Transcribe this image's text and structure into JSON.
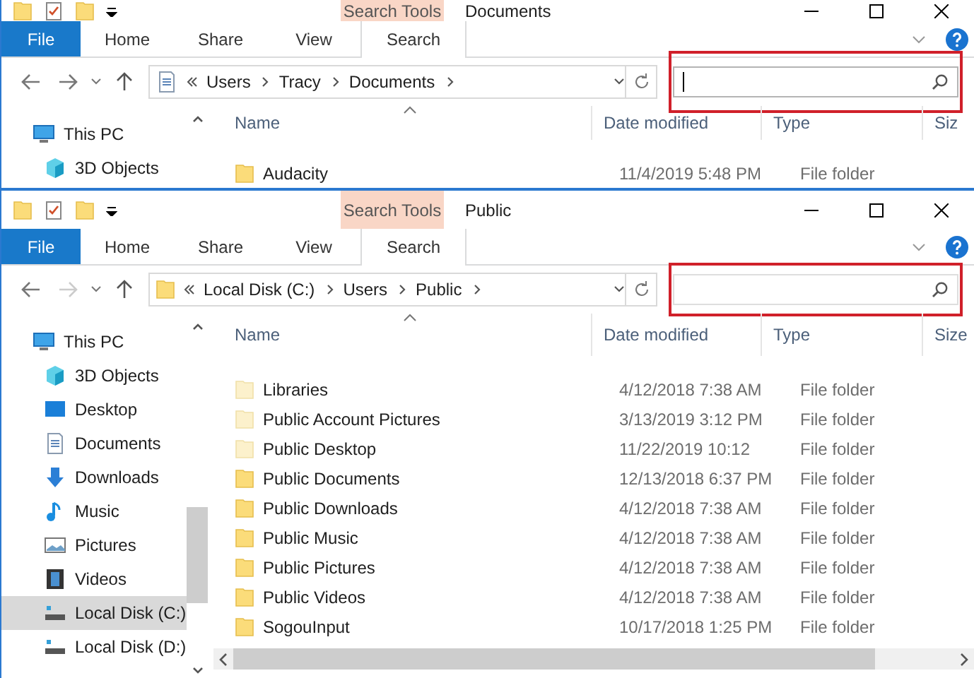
{
  "windows": [
    {
      "title": "Documents",
      "context_tab": "Search Tools",
      "ribbon_tabs": [
        {
          "label": "File",
          "kind": "file",
          "selected": false
        },
        {
          "label": "Home",
          "kind": "tab",
          "selected": false
        },
        {
          "label": "Share",
          "kind": "tab",
          "selected": false
        },
        {
          "label": "View",
          "kind": "tab",
          "selected": false
        },
        {
          "label": "Search",
          "kind": "tab",
          "selected": true
        }
      ],
      "location": {
        "kind": "documents"
      },
      "breadcrumb": [
        "Users",
        "Tracy",
        "Documents"
      ],
      "forward_enabled": true,
      "search": {
        "focused": true,
        "highlighted": true
      },
      "sidebar": [
        {
          "label": "This PC",
          "kind": "pc",
          "selected": false
        },
        {
          "label": "3D Objects",
          "kind": "objects",
          "selected": false
        }
      ],
      "columns": [
        "Name",
        "Date modified",
        "Type",
        "Siz"
      ],
      "rows": [
        {
          "name": "Audacity",
          "date": "11/4/2019 5:48 PM",
          "type": "File folder",
          "hidden": false
        }
      ]
    },
    {
      "title": "Public",
      "context_tab": "Search Tools",
      "ribbon_tabs": [
        {
          "label": "File",
          "kind": "file",
          "selected": false
        },
        {
          "label": "Home",
          "kind": "tab",
          "selected": false
        },
        {
          "label": "Share",
          "kind": "tab",
          "selected": false
        },
        {
          "label": "View",
          "kind": "tab",
          "selected": false
        },
        {
          "label": "Search",
          "kind": "tab",
          "selected": true
        }
      ],
      "location": {
        "kind": "folder"
      },
      "breadcrumb": [
        "Local Disk (C:)",
        "Users",
        "Public"
      ],
      "forward_enabled": false,
      "search": {
        "focused": false,
        "highlighted": true
      },
      "sidebar": [
        {
          "label": "This PC",
          "kind": "pc",
          "selected": false
        },
        {
          "label": "3D Objects",
          "kind": "objects",
          "selected": false
        },
        {
          "label": "Desktop",
          "kind": "desktop",
          "selected": false
        },
        {
          "label": "Documents",
          "kind": "documents",
          "selected": false
        },
        {
          "label": "Downloads",
          "kind": "downloads",
          "selected": false
        },
        {
          "label": "Music",
          "kind": "music",
          "selected": false
        },
        {
          "label": "Pictures",
          "kind": "pictures",
          "selected": false
        },
        {
          "label": "Videos",
          "kind": "videos",
          "selected": false
        },
        {
          "label": "Local Disk (C:)",
          "kind": "drive",
          "selected": true
        },
        {
          "label": "Local Disk (D:)",
          "kind": "drive",
          "selected": false
        }
      ],
      "columns": [
        "Name",
        "Date modified",
        "Type",
        "Size"
      ],
      "rows": [
        {
          "name": "Libraries",
          "date": "4/12/2018 7:38 AM",
          "type": "File folder",
          "hidden": true
        },
        {
          "name": "Public Account Pictures",
          "date": "3/13/2019 3:12 PM",
          "type": "File folder",
          "hidden": true
        },
        {
          "name": "Public Desktop",
          "date": "11/22/2019 10:12",
          "type": "File folder",
          "hidden": true
        },
        {
          "name": "Public Documents",
          "date": "12/13/2018 6:37 PM",
          "type": "File folder",
          "hidden": false
        },
        {
          "name": "Public Downloads",
          "date": "4/12/2018 7:38 AM",
          "type": "File folder",
          "hidden": false
        },
        {
          "name": "Public Music",
          "date": "4/12/2018 7:38 AM",
          "type": "File folder",
          "hidden": false
        },
        {
          "name": "Public Pictures",
          "date": "4/12/2018 7:38 AM",
          "type": "File folder",
          "hidden": false
        },
        {
          "name": "Public Videos",
          "date": "4/12/2018 7:38 AM",
          "type": "File folder",
          "hidden": false
        },
        {
          "name": "SogouInput",
          "date": "10/17/2018 1:25 PM",
          "type": "File folder",
          "hidden": false
        }
      ]
    }
  ]
}
